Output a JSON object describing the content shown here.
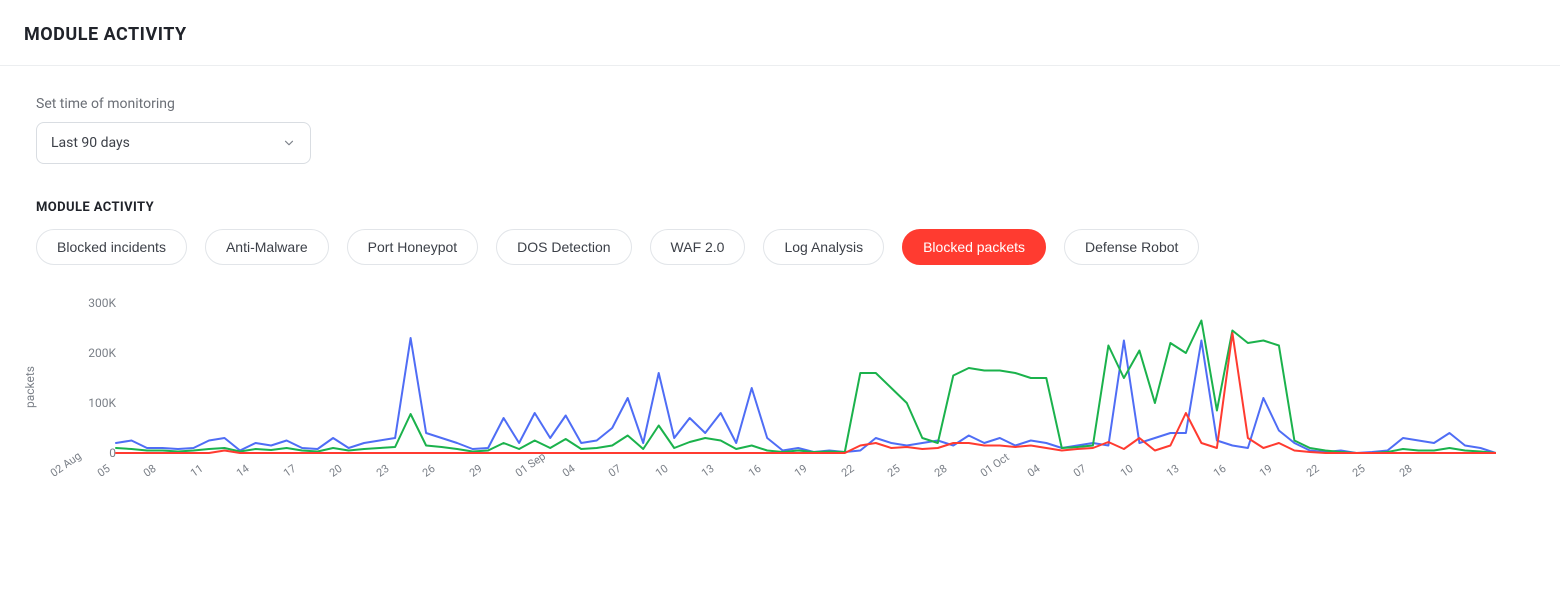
{
  "header": {
    "title": "MODULE ACTIVITY"
  },
  "controls": {
    "time_label": "Set time of monitoring",
    "time_value": "Last 90 days"
  },
  "section": {
    "title": "MODULE ACTIVITY"
  },
  "tabs": [
    {
      "label": "Blocked incidents",
      "active": false
    },
    {
      "label": "Anti-Malware",
      "active": false
    },
    {
      "label": "Port Honeypot",
      "active": false
    },
    {
      "label": "DOS Detection",
      "active": false
    },
    {
      "label": "WAF 2.0",
      "active": false
    },
    {
      "label": "Log Analysis",
      "active": false
    },
    {
      "label": "Blocked packets",
      "active": true
    },
    {
      "label": "Defense Robot",
      "active": false
    }
  ],
  "chart_data": {
    "type": "line",
    "title": "",
    "xlabel": "",
    "ylabel": "packets",
    "ylim": [
      0,
      300000
    ],
    "yticks": [
      0,
      100000,
      200000,
      300000
    ],
    "ytick_labels": [
      "0",
      "100K",
      "200K",
      "300K"
    ],
    "categories": [
      "02 Aug",
      "03",
      "04",
      "05",
      "06",
      "07",
      "08",
      "09",
      "10",
      "11",
      "12",
      "13",
      "14",
      "15",
      "16",
      "17",
      "18",
      "19",
      "20",
      "21",
      "22",
      "23",
      "24",
      "25",
      "26",
      "27",
      "28",
      "29",
      "30",
      "31",
      "01 Sep",
      "02",
      "03",
      "04",
      "05",
      "06",
      "07",
      "08",
      "09",
      "10",
      "11",
      "12",
      "13",
      "14",
      "15",
      "16",
      "17",
      "18",
      "19",
      "20",
      "21",
      "22",
      "23",
      "24",
      "25",
      "26",
      "27",
      "28",
      "29",
      "30",
      "01 Oct",
      "02",
      "03",
      "04",
      "05",
      "06",
      "07",
      "08",
      "09",
      "10",
      "11",
      "12",
      "13",
      "14",
      "15",
      "16",
      "17",
      "18",
      "19",
      "20",
      "21",
      "22",
      "23",
      "24",
      "25",
      "26",
      "27",
      "28",
      "29",
      "30"
    ],
    "xtick_labels": [
      "02 Aug",
      "05",
      "08",
      "11",
      "14",
      "17",
      "20",
      "23",
      "26",
      "29",
      "01 Sep",
      "04",
      "07",
      "10",
      "13",
      "16",
      "19",
      "22",
      "25",
      "28",
      "01 Oct",
      "04",
      "07",
      "10",
      "13",
      "16",
      "19",
      "22",
      "25",
      "28"
    ],
    "series": [
      {
        "name": "series-blue",
        "color": "#4f6df5",
        "values": [
          20000,
          25000,
          10000,
          10000,
          8000,
          10000,
          25000,
          30000,
          5000,
          20000,
          15000,
          25000,
          10000,
          8000,
          30000,
          10000,
          20000,
          25000,
          30000,
          230000,
          40000,
          30000,
          20000,
          8000,
          10000,
          70000,
          20000,
          80000,
          30000,
          75000,
          20000,
          25000,
          50000,
          110000,
          20000,
          160000,
          30000,
          70000,
          40000,
          80000,
          20000,
          130000,
          30000,
          5000,
          10000,
          2000,
          5000,
          2000,
          5000,
          30000,
          20000,
          15000,
          20000,
          25000,
          15000,
          35000,
          20000,
          30000,
          15000,
          25000,
          20000,
          10000,
          15000,
          20000,
          15000,
          225000,
          20000,
          30000,
          40000,
          40000,
          225000,
          25000,
          15000,
          10000,
          110000,
          45000,
          20000,
          5000,
          2000,
          5000,
          0,
          2000,
          5000,
          30000,
          25000,
          20000,
          40000,
          15000,
          10000,
          0
        ]
      },
      {
        "name": "series-green",
        "color": "#1bb24c",
        "values": [
          10000,
          8000,
          5000,
          5000,
          3000,
          5000,
          8000,
          10000,
          3000,
          8000,
          6000,
          10000,
          5000,
          3000,
          10000,
          5000,
          8000,
          10000,
          12000,
          78000,
          15000,
          12000,
          8000,
          3000,
          5000,
          20000,
          8000,
          25000,
          10000,
          28000,
          8000,
          10000,
          15000,
          35000,
          8000,
          55000,
          10000,
          22000,
          30000,
          25000,
          8000,
          15000,
          5000,
          2000,
          5000,
          2000,
          3000,
          2000,
          160000,
          160000,
          130000,
          100000,
          30000,
          20000,
          155000,
          170000,
          165000,
          165000,
          160000,
          150000,
          150000,
          10000,
          12000,
          15000,
          215000,
          150000,
          205000,
          100000,
          220000,
          200000,
          265000,
          85000,
          245000,
          220000,
          225000,
          215000,
          25000,
          10000,
          5000,
          2000,
          0,
          0,
          2000,
          8000,
          5000,
          5000,
          10000,
          5000,
          3000,
          0
        ]
      },
      {
        "name": "series-red",
        "color": "#ff3b30",
        "values": [
          0,
          0,
          0,
          0,
          0,
          0,
          0,
          5000,
          0,
          0,
          0,
          0,
          0,
          0,
          0,
          0,
          0,
          0,
          0,
          0,
          0,
          0,
          0,
          0,
          0,
          0,
          0,
          0,
          0,
          0,
          0,
          0,
          0,
          0,
          0,
          0,
          0,
          0,
          0,
          0,
          0,
          0,
          0,
          0,
          0,
          0,
          0,
          0,
          15000,
          20000,
          10000,
          12000,
          8000,
          10000,
          20000,
          20000,
          15000,
          15000,
          12000,
          15000,
          10000,
          5000,
          8000,
          10000,
          22000,
          8000,
          30000,
          5000,
          15000,
          80000,
          20000,
          10000,
          240000,
          30000,
          10000,
          20000,
          5000,
          2000,
          0,
          0,
          0,
          0,
          0,
          0,
          0,
          0,
          0,
          0,
          0,
          0
        ]
      }
    ]
  }
}
